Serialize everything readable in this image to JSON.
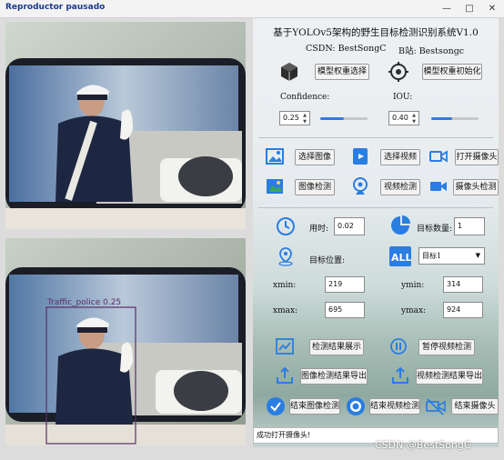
{
  "window": {
    "title": "Reproductor pausado"
  },
  "top_image": {
    "caption": ""
  },
  "bottom_image": {
    "detection_label": "Traffic_police  0.25"
  },
  "header": {
    "title": "基于YOLOv5架构的野生目标检测识别系统V1.0",
    "csdn": "CSDN:   BestSongC",
    "bsite": "B站:  Bestsongc"
  },
  "model": {
    "select_label": "模型权重选择",
    "init_label": "模型权重初始化"
  },
  "thresholds": {
    "confidence_label": "Confidence:",
    "confidence_value": "0.25",
    "confidence_level": 0.5,
    "iou_label": "IOU:",
    "iou_value": "0.40",
    "iou_level": 0.45
  },
  "actions": {
    "select_image": "选择图像",
    "select_video": "选择视频",
    "open_camera": "打开摄像头",
    "image_detect": "图像检测",
    "video_detect": "视频检测",
    "camera_detect": "摄像头检测"
  },
  "results": {
    "time_label": "用时:",
    "time_value": "0.02",
    "count_label": "目标数量:",
    "count_value": "1",
    "position_label": "目标位置:",
    "target_select": "目标1",
    "xmin_label": "xmin:",
    "xmin_value": "219",
    "ymin_label": "ymin:",
    "ymin_value": "314",
    "xmax_label": "xmax:",
    "xmax_value": "695",
    "ymax_label": "ymax:",
    "ymax_value": "924"
  },
  "bottom_actions": {
    "show_results": "检测结果展示",
    "pause_video": "暂停视频检测",
    "export_image": "图像检测结果导出",
    "export_video": "视频检测结果导出",
    "end_image": "结束图像检测",
    "end_video": "结束视频检测",
    "end_camera": "结束摄像头"
  },
  "status": {
    "message": "成功打开摄像头!"
  },
  "watermark": "CSDN @BestSongC",
  "colors": {
    "accent": "#2f7be0",
    "detection_box": "#5a2d6a"
  }
}
